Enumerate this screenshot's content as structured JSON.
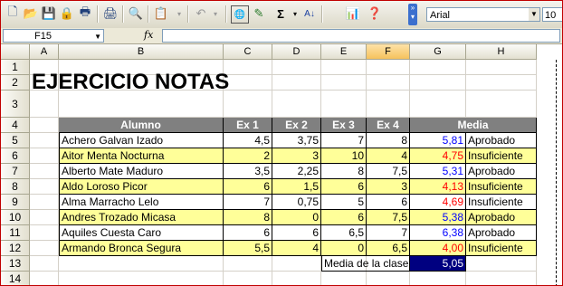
{
  "toolbar": {
    "font_name": "Arial",
    "font_size": "10",
    "icons": [
      "new-icon",
      "open-icon",
      "save-icon",
      "permission-icon",
      "print-icon",
      "print-preview-icon",
      "research-icon",
      "paste-icon",
      "undo-icon",
      "hyperlink-icon",
      "drawing-icon",
      "autosum-icon",
      "sort-ascending-icon",
      "chart-wizard-icon",
      "help-icon"
    ],
    "autosum_symbol": "Σ"
  },
  "formula_bar": {
    "name_box": "F15",
    "fx_label": "fx",
    "content": ""
  },
  "columns": [
    "A",
    "B",
    "C",
    "D",
    "E",
    "F",
    "G",
    "H"
  ],
  "selected_column": "F",
  "rows": [
    "1",
    "2",
    "3",
    "4",
    "5",
    "6",
    "7",
    "8",
    "9",
    "10",
    "11",
    "12",
    "13",
    "14"
  ],
  "sheet": {
    "title": "EJERCICIO NOTAS",
    "headers": [
      "Alumno",
      "Ex 1",
      "Ex 2",
      "Ex 3",
      "Ex 4",
      "Media"
    ],
    "students": [
      {
        "name": "Achero Galvan Izado",
        "ex1": "4,5",
        "ex2": "3,75",
        "ex3": "7",
        "ex4": "8",
        "media": "5,81",
        "result": "Aprobado"
      },
      {
        "name": "Aitor Menta Nocturna",
        "ex1": "2",
        "ex2": "3",
        "ex3": "10",
        "ex4": "4",
        "media": "4,75",
        "result": "Insuficiente"
      },
      {
        "name": "Alberto Mate Maduro",
        "ex1": "3,5",
        "ex2": "2,25",
        "ex3": "8",
        "ex4": "7,5",
        "media": "5,31",
        "result": "Aprobado"
      },
      {
        "name": "Aldo Loroso Picor",
        "ex1": "6",
        "ex2": "1,5",
        "ex3": "6",
        "ex4": "3",
        "media": "4,13",
        "result": "Insuficiente"
      },
      {
        "name": "Alma Marracho Lelo",
        "ex1": "7",
        "ex2": "0,75",
        "ex3": "5",
        "ex4": "6",
        "media": "4,69",
        "result": "Insuficiente"
      },
      {
        "name": "Andres Trozado Micasa",
        "ex1": "8",
        "ex2": "0",
        "ex3": "6",
        "ex4": "7,5",
        "media": "5,38",
        "result": "Aprobado"
      },
      {
        "name": "Aquiles Cuesta Caro",
        "ex1": "6",
        "ex2": "6",
        "ex3": "6,5",
        "ex4": "7",
        "media": "6,38",
        "result": "Aprobado"
      },
      {
        "name": "Armando Bronca Segura",
        "ex1": "5,5",
        "ex2": "4",
        "ex3": "0",
        "ex4": "6,5",
        "media": "4,00",
        "result": "Insuficiente"
      }
    ],
    "class_average_label": "Media de la clase:",
    "class_average_value": "5,05"
  },
  "colors": {
    "header_bg": "#808080",
    "highlight_row": "#ffff99",
    "pass_color": "#0000ff",
    "fail_color": "#ff0000",
    "average_bg": "#000080"
  }
}
